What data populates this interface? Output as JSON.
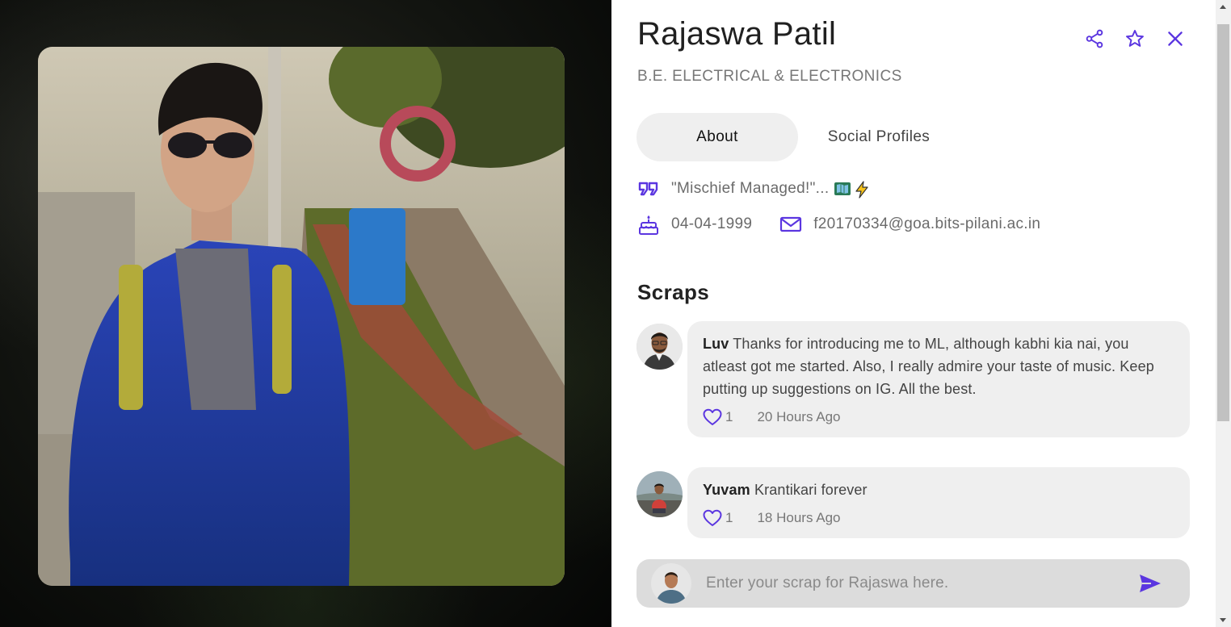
{
  "profile": {
    "name": "Rajaswa Patil",
    "degree": "B.E. ELECTRICAL & ELECTRONICS",
    "quote": "\"Mischief Managed!\"...",
    "quote_emoji": [
      "map-book-emoji",
      "lightning-emoji"
    ],
    "birthday": "04-04-1999",
    "email": "f20170334@goa.bits-pilani.ac.in"
  },
  "actions": {
    "share_icon": "share-icon",
    "star_icon": "star-icon",
    "close_icon": "close-icon"
  },
  "tabs": [
    {
      "label": "About",
      "active": true
    },
    {
      "label": "Social Profiles",
      "active": false
    }
  ],
  "scraps": {
    "title": "Scraps",
    "items": [
      {
        "author": "Luv",
        "text": "Thanks for introducing me to ML, although kabhi kia nai, you atleast got me started. Also, I really admire your taste of music. Keep putting up suggestions on IG. All the best.",
        "likes": "1",
        "time": "20 Hours Ago"
      },
      {
        "author": "Yuvam",
        "text": "Krantikari forever",
        "likes": "1",
        "time": "18 Hours Ago"
      }
    ]
  },
  "compose": {
    "placeholder": "Enter your scrap for Rajaswa here."
  },
  "colors": {
    "accent": "#5b36e0",
    "text_muted": "#777777",
    "bubble_bg": "#efefef",
    "compose_bg": "#dcdcdc"
  }
}
